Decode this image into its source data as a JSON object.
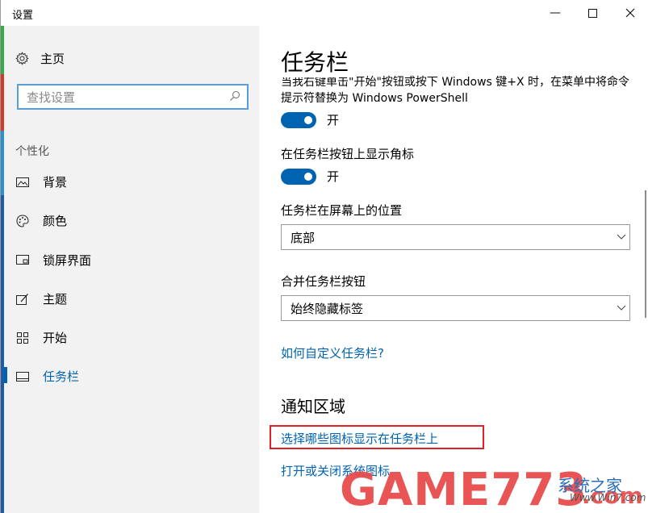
{
  "window": {
    "title": "设置",
    "controls": {
      "minimize": "—",
      "maximize": "☐",
      "close": "✕"
    }
  },
  "sidebar": {
    "home_label": "主页",
    "search_placeholder": "查找设置",
    "section_label": "个性化",
    "items": [
      {
        "label": "背景",
        "icon": "image-icon"
      },
      {
        "label": "颜色",
        "icon": "palette-icon"
      },
      {
        "label": "锁屏界面",
        "icon": "lock-screen-icon"
      },
      {
        "label": "主题",
        "icon": "theme-icon"
      },
      {
        "label": "开始",
        "icon": "start-icon"
      },
      {
        "label": "任务栏",
        "icon": "taskbar-icon",
        "active": true
      }
    ]
  },
  "main": {
    "title": "任务栏",
    "powershell_desc": "当我右键单击\"开始\"按钮或按下 Windows 键+X 时，在菜单中将命令提示符替换为 Windows PowerShell",
    "powershell_toggle": {
      "state": "开",
      "on": true
    },
    "badge_label": "在任务栏按钮上显示角标",
    "badge_toggle": {
      "state": "开",
      "on": true
    },
    "position_label": "任务栏在屏幕上的位置",
    "position_value": "底部",
    "combine_label": "合并任务栏按钮",
    "combine_value": "始终隐藏标签",
    "help_link": "如何自定义任务栏?",
    "notify_title": "通知区域",
    "select_icons_link": "选择哪些图标显示在任务栏上",
    "system_icons_link": "打开或关闭系统图标"
  },
  "watermark": {
    "brand": "GAME773",
    "com": ".com",
    "site": "系统之家",
    "small": "Www.Win7.com"
  },
  "colors": {
    "accent": "#0063b1",
    "highlight_border": "#e0212a",
    "sidebar_bg": "#f2f2f2"
  }
}
